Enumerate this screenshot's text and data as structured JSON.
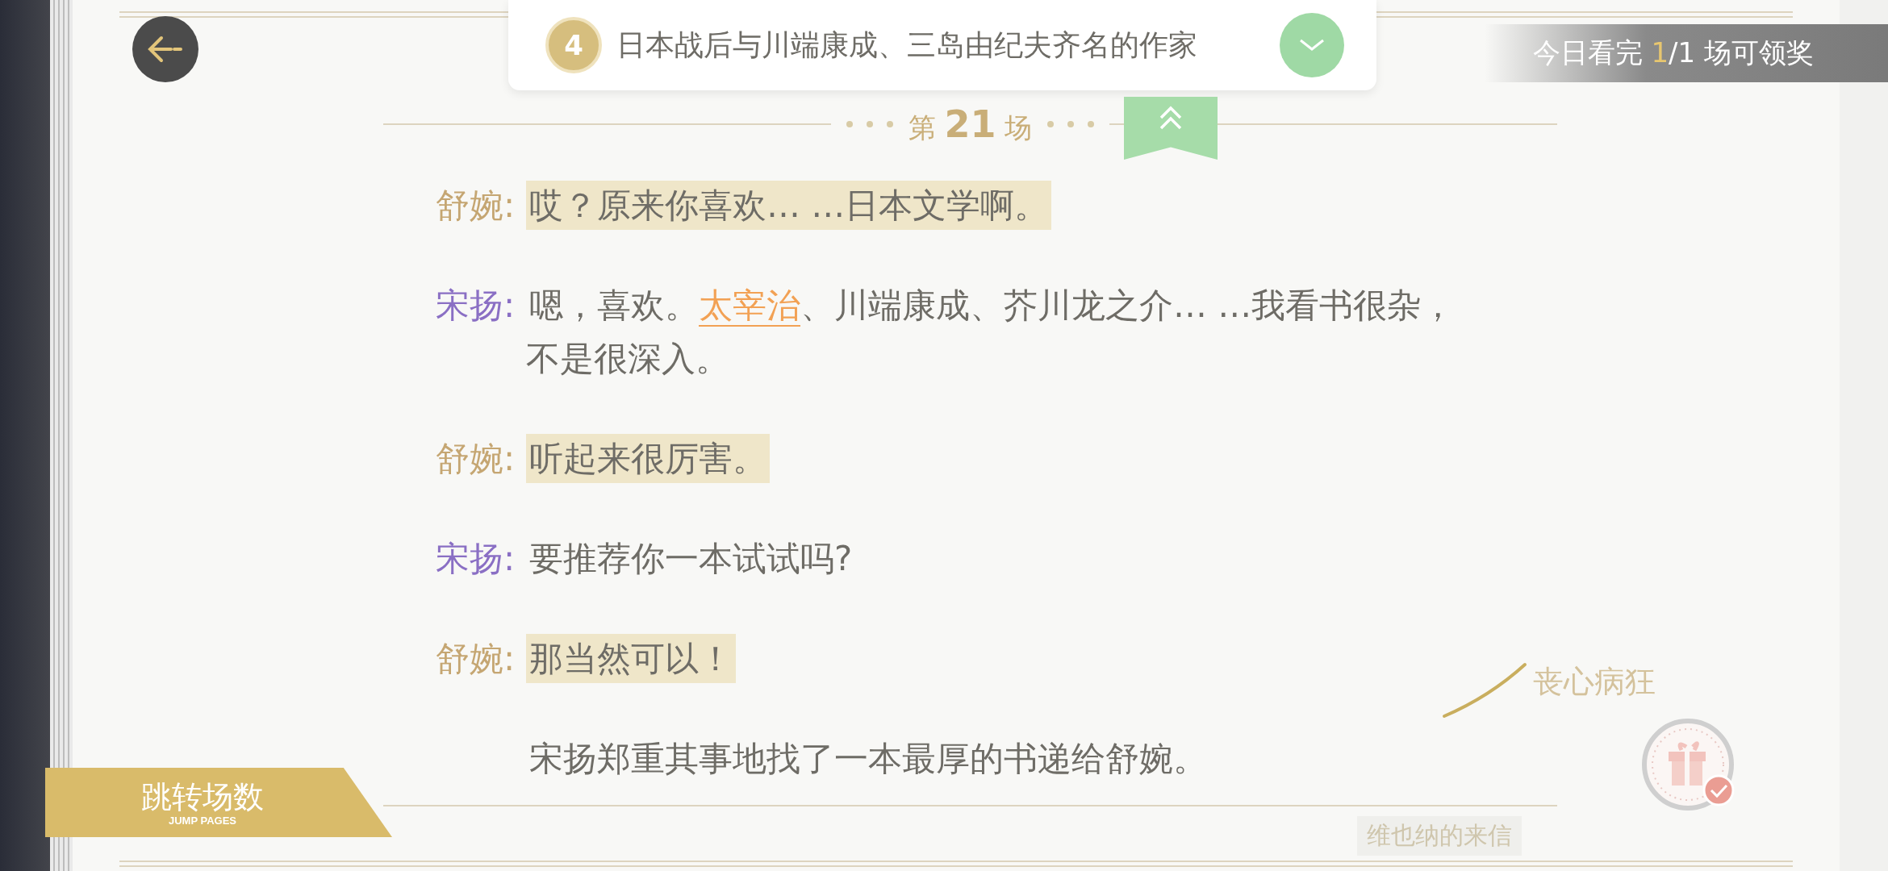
{
  "quest": {
    "number": "4",
    "text": "日本战后与川端康成、三岛由纪夫齐名的作家",
    "completed": true
  },
  "reward_banner": {
    "prefix": "今日看完",
    "count": "1",
    "rest": "/1 场可领奖"
  },
  "chapter": {
    "prefix": "第",
    "number": "21",
    "suffix": "场"
  },
  "dialogue": [
    {
      "kind": "speech",
      "speaker": "舒婉:",
      "color": "#c5a672",
      "highlighted": true,
      "segments": [
        {
          "kind": "plain",
          "text": "哎？原来你喜欢… …日本文学啊。"
        }
      ]
    },
    {
      "kind": "speech",
      "speaker": "宋扬:",
      "color": "#8a6fc4",
      "highlighted": false,
      "segments": [
        {
          "kind": "plain",
          "text": "嗯，喜欢。"
        },
        {
          "kind": "keyword",
          "text": "太宰治"
        },
        {
          "kind": "plain",
          "text": "、川端康成、芥川龙之介… …我看书很杂，不是很深入。"
        }
      ]
    },
    {
      "kind": "speech",
      "speaker": "舒婉:",
      "color": "#c5a672",
      "highlighted": true,
      "segments": [
        {
          "kind": "plain",
          "text": "听起来很厉害。"
        }
      ]
    },
    {
      "kind": "speech",
      "speaker": "宋扬:",
      "color": "#8a6fc4",
      "highlighted": false,
      "segments": [
        {
          "kind": "plain",
          "text": "要推荐你一本试试吗?"
        }
      ]
    },
    {
      "kind": "speech",
      "speaker": "舒婉:",
      "color": "#c5a672",
      "highlighted": true,
      "segments": [
        {
          "kind": "plain",
          "text": "那当然可以！"
        }
      ]
    },
    {
      "kind": "narration",
      "segments": [
        {
          "kind": "plain",
          "text": "宋扬郑重其事地找了一本最厚的书递给舒婉。"
        }
      ]
    }
  ],
  "annotation": {
    "text": "丧心病狂"
  },
  "gift": {
    "claimed": true
  },
  "jump_button": {
    "label": "跳转场数",
    "sublabel": "JUMP PAGES"
  },
  "story_tag": "维也纳的来信"
}
